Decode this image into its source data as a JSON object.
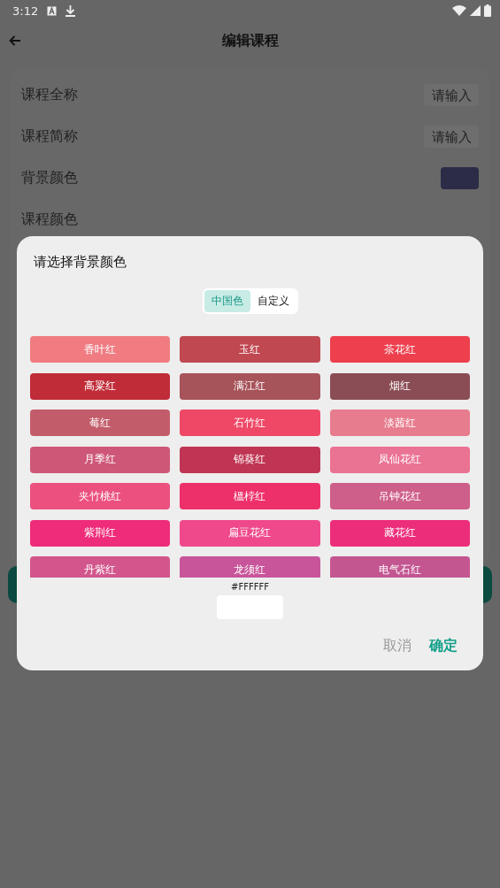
{
  "status_bar": {
    "time": "3:12"
  },
  "toolbar": {
    "title": "编辑课程"
  },
  "form": {
    "rows": [
      {
        "kind": "input",
        "label": "课程全称",
        "placeholder": "请输入"
      },
      {
        "kind": "input",
        "label": "课程简称",
        "placeholder": "请输入"
      },
      {
        "kind": "swatch",
        "label": "背景颜色",
        "color": "#2c2c48"
      },
      {
        "kind": "plain",
        "label": "课程颜色"
      }
    ]
  },
  "dialog": {
    "title": "请选择背景颜色",
    "tabs": [
      {
        "label": "中国色",
        "selected": true
      },
      {
        "label": "自定义",
        "selected": false
      }
    ],
    "colors": [
      {
        "name": "香叶红",
        "color": "#f07c82"
      },
      {
        "name": "玉红",
        "color": "#c04851"
      },
      {
        "name": "茶花红",
        "color": "#ee3f4d"
      },
      {
        "name": "高粱红",
        "color": "#c02c38"
      },
      {
        "name": "满江红",
        "color": "#a7535a"
      },
      {
        "name": "烟红",
        "color": "#8b4d55"
      },
      {
        "name": "莓红",
        "color": "#c35c6a"
      },
      {
        "name": "石竹红",
        "color": "#ee4866"
      },
      {
        "name": "淡茜红",
        "color": "#e77c8e"
      },
      {
        "name": "月季红",
        "color": "#ce5777"
      },
      {
        "name": "锦葵红",
        "color": "#bf3553"
      },
      {
        "name": "凤仙花红",
        "color": "#ea7293"
      },
      {
        "name": "夹竹桃红",
        "color": "#eb507e"
      },
      {
        "name": "榲桲红",
        "color": "#ed2f6a"
      },
      {
        "name": "吊钟花红",
        "color": "#ce5e8a"
      },
      {
        "name": "紫荆红",
        "color": "#ee2c79"
      },
      {
        "name": "扁豆花红",
        "color": "#ef498b"
      },
      {
        "name": "藏花红",
        "color": "#ec2d7a"
      },
      {
        "name": "丹紫红",
        "color": "#d2568c"
      },
      {
        "name": "龙须红",
        "color": "#c8559a"
      },
      {
        "name": "电气石红",
        "color": "#c35691"
      }
    ],
    "hex": "#FFFFFF",
    "buttons": [
      {
        "kind": "cancel",
        "label": "取消"
      },
      {
        "kind": "confirm",
        "label": "确定"
      }
    ]
  }
}
